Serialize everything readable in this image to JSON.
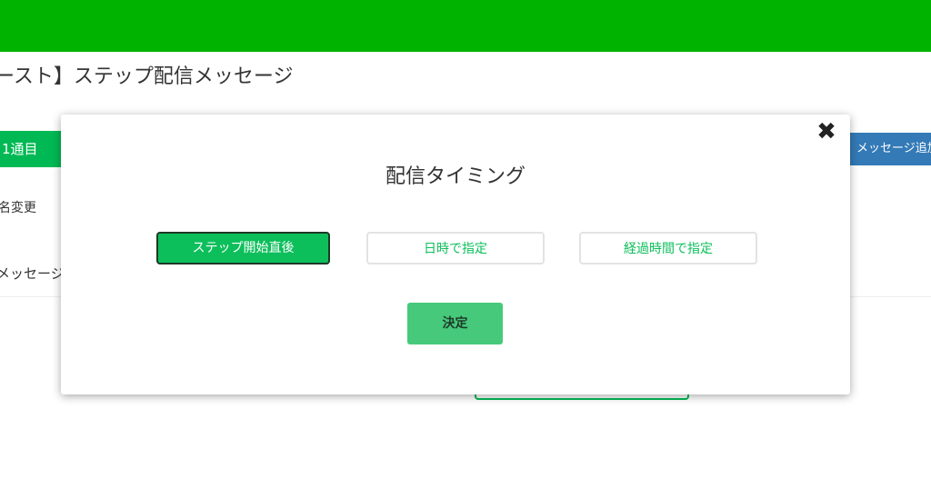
{
  "page": {
    "title": "ースト】ステップ配信メッセージ",
    "step_tab": "1通目",
    "rename_link": "名変更",
    "message_label": "メッセージ",
    "add_message_button": "メッセージ追加",
    "brand_color": "#00b300"
  },
  "modal": {
    "title": "配信タイミング",
    "close_icon": "close-icon",
    "options": [
      {
        "label": "ステップ開始直後",
        "selected": true
      },
      {
        "label": "日時で指定",
        "selected": false
      },
      {
        "label": "経過時間で指定",
        "selected": false
      }
    ],
    "confirm_label": "決定",
    "accent_color": "#0dbf5b"
  }
}
